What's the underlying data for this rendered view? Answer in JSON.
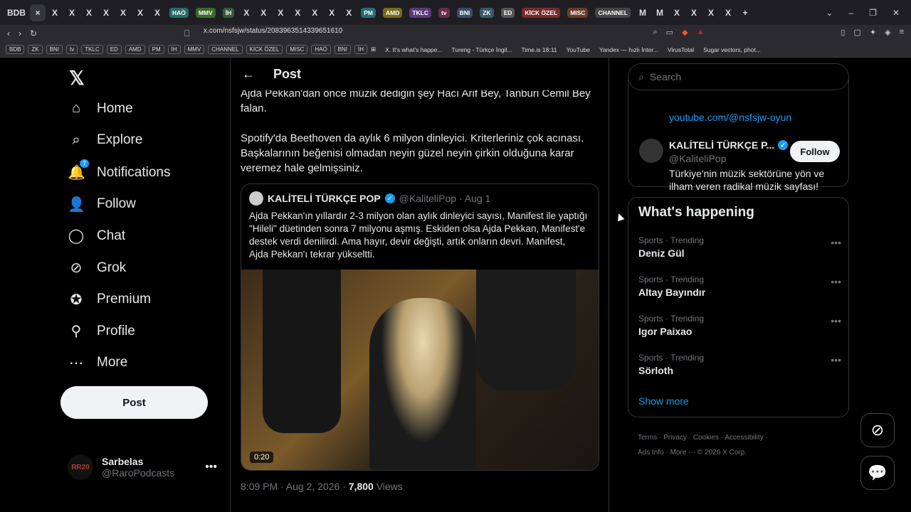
{
  "tabs": [
    "BDB",
    "×",
    "X",
    "X",
    "X",
    "X",
    "X",
    "X",
    "X",
    "HAÖ",
    "MMV",
    "İH",
    "X",
    "X",
    "X",
    "X",
    "X",
    "X",
    "X",
    "PM",
    "AMD",
    "TKLC",
    "tv",
    "BNI",
    "ZK",
    "ED",
    "KİCK ÖZEL",
    "MISC",
    "CHANNEL",
    "M",
    "M",
    "X",
    "X",
    "X",
    "X",
    "+"
  ],
  "tab_colors": {
    "HAÖ": "#2a6a6a",
    "MMV": "#3a6a2a",
    "İH": "#3a5a3a",
    "PM": "#2a6a7a",
    "AMD": "#7a6a1a",
    "TKLC": "#5a3a7a",
    "tv": "#6a2a4a",
    "BNI": "#3a4a6a",
    "ZK": "#3a5a6a",
    "ED": "#555",
    "KİCK ÖZEL": "#7a2a2a",
    "MISC": "#6a3a2a",
    "CHANNEL": "#444"
  },
  "url": "x.com/nsfsjw/status/2083963514339651610",
  "bookmarks": {
    "chips": [
      "BDB",
      "ZK",
      "BNI",
      "tv",
      "TKLC",
      "ED",
      "AMD",
      "PM",
      "İH",
      "MMV",
      "CHANNEL",
      "KİCK ÖZEL",
      "MISC",
      "HAÖ",
      "BNI",
      "İH"
    ],
    "links": [
      "X. It's what's happe...",
      "Tureng - Türkçe İngil...",
      "Time.is 18:11",
      "YouTube",
      "Yandex — hızlı İnter...",
      "VirusTotal",
      "Sugar vectors, phot..."
    ]
  },
  "nav": {
    "items": [
      {
        "label": "Home",
        "icon": "home-icon"
      },
      {
        "label": "Explore",
        "icon": "search-icon"
      },
      {
        "label": "Notifications",
        "icon": "bell-icon",
        "badge": "7"
      },
      {
        "label": "Follow",
        "icon": "follow-icon"
      },
      {
        "label": "Chat",
        "icon": "chat-icon"
      },
      {
        "label": "Grok",
        "icon": "grok-icon"
      },
      {
        "label": "Premium",
        "icon": "premium-icon"
      },
      {
        "label": "Profile",
        "icon": "profile-icon"
      },
      {
        "label": "More",
        "icon": "more-icon"
      }
    ],
    "post_label": "Post"
  },
  "account": {
    "name": "Sarbelas",
    "handle": "@RaroPodcasts",
    "avatar_text": "RR20"
  },
  "header": {
    "title": "Post"
  },
  "post": {
    "line1": "Ajda Pekkan'dan önce müzik dediğin şey Hacı Arif Bey, Tanburi Cemil Bey",
    "line2": "falan.",
    "para2_l1": "Spotify'da Beethoven da aylık 6 milyon dinleyici. Kriterleriniz çok acınası.",
    "para2_l2": "Başkalarının beğenisi olmadan neyin güzel neyin çirkin olduğuna karar",
    "para2_l3": "veremez hale gelmişsiniz.",
    "time": "8:09 PM · Aug 2, 2026 · ",
    "views_count": "7,800",
    "views_label": " Views"
  },
  "quote": {
    "name": "KALİTELİ TÜRKÇE POP",
    "handle_date": "@KaliteliPop · Aug 1",
    "l1": "Ajda Pekkan'ın yıllardır 2-3 milyon olan aylık dinleyici sayısı, Manifest ile yaptığı",
    "l2": "\"Hileli\" düetinden sonra 7 milyonu aşmış. Eskiden olsa Ajda Pekkan, Manifest'e",
    "l3": "destek verdi denilirdi. Ama hayır, devir değişti, artık onların devri. Manifest,",
    "l4": "Ajda Pekkan'ı tekrar yükseltti.",
    "duration": "0:20"
  },
  "search": {
    "placeholder": "Search"
  },
  "who_to_follow": {
    "youtube": "youtube.com/@nsfsjw-oyun",
    "name": "KALİTELİ TÜRKÇE P...",
    "handle": "@KaliteliPop",
    "bio": "Türkiye'nin müzik sektörüne yön ve ilham veren radikal müzik sayfası!",
    "follow_label": "Follow"
  },
  "happening": {
    "title": "What's happening",
    "trends": [
      {
        "cat": "Sports · Trending",
        "name": "Deniz Gül"
      },
      {
        "cat": "Sports · Trending",
        "name": "Altay Bayındır"
      },
      {
        "cat": "Sports · Trending",
        "name": "Igor Paixao"
      },
      {
        "cat": "Sports · Trending",
        "name": "Sörloth"
      }
    ],
    "show_more": "Show more"
  },
  "footer": {
    "row1": "Terms  ·  Privacy  ·  Cookies  ·  Accessibility  ·",
    "row2": "Ads Info  ·  More ···  © 2026 X Corp."
  }
}
